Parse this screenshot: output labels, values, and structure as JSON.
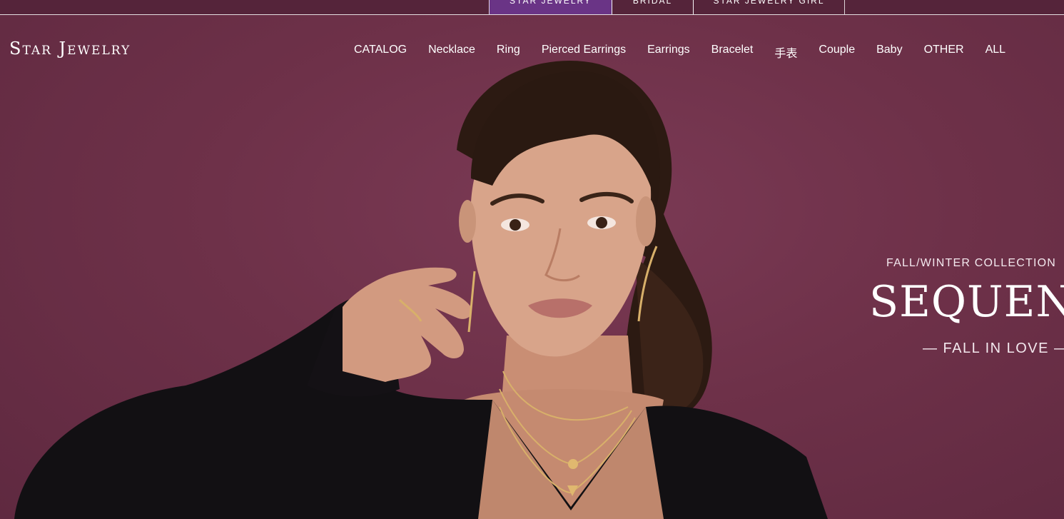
{
  "brand_tabs": [
    {
      "label": "STAR JEWELRY",
      "active": true
    },
    {
      "label": "BRIDAL",
      "active": false
    },
    {
      "label": "STAR JEWELRY GIRL",
      "active": false
    }
  ],
  "header": {
    "logo": "Star Jewelry",
    "nav": [
      "CATALOG",
      "Necklace",
      "Ring",
      "Pierced Earrings",
      "Earrings",
      "Bracelet",
      "手表",
      "Couple",
      "Baby",
      "OTHER",
      "ALL"
    ]
  },
  "hero": {
    "kicker": "FALL/WINTER COLLECTION",
    "title": "SEQUENC",
    "tagline": "— FALL IN LOVE —"
  },
  "colors": {
    "background": "#6e3149",
    "active_tab": "#6a3486",
    "text": "#ffffff"
  }
}
